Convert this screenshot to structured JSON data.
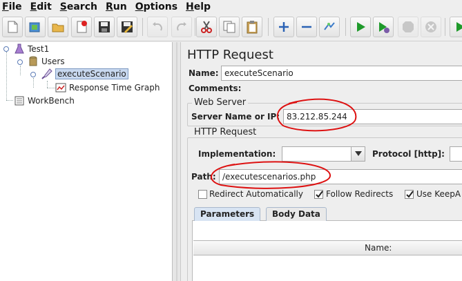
{
  "menubar": {
    "items": [
      {
        "mnemonic": "F",
        "rest": "ile"
      },
      {
        "mnemonic": "E",
        "rest": "dit"
      },
      {
        "mnemonic": "S",
        "rest": "earch"
      },
      {
        "mnemonic": "R",
        "rest": "un"
      },
      {
        "mnemonic": "O",
        "rest": "ptions"
      },
      {
        "mnemonic": "H",
        "rest": "elp"
      }
    ]
  },
  "toolbar": {
    "buttons": [
      "new-icon",
      "templates-icon",
      "open-icon",
      "close-icon",
      "save-icon",
      "save-as-icon",
      "undo-icon",
      "redo-icon",
      "cut-icon",
      "copy-icon",
      "paste-icon",
      "expand-icon",
      "collapse-icon",
      "toggle-icon",
      "start-icon",
      "start-no-pause-icon",
      "stop-icon",
      "shutdown-icon",
      "remote-start-icon"
    ]
  },
  "tree": {
    "test_plan": "Test1",
    "thread_group": "Users",
    "sampler": "executeScenario",
    "listener": "Response Time Graph",
    "workbench": "WorkBench"
  },
  "panel": {
    "title": "HTTP Request",
    "name_label": "Name:",
    "name_value": "executeScenario",
    "comments_label": "Comments:",
    "web_server": {
      "title": "Web Server",
      "server_label": "Server Name or IP:",
      "server_value": "83.212.85.244"
    },
    "http_request": {
      "title": "HTTP Request",
      "implementation_label": "Implementation:",
      "implementation_value": "",
      "protocol_label": "Protocol [http]:",
      "protocol_value": "",
      "path_label": "Path:",
      "path_value": "/executescenarios.php",
      "redirect_label": "Redirect Automatically",
      "redirect_checked": false,
      "follow_label": "Follow Redirects",
      "follow_checked": true,
      "keepalive_label": "Use KeepA",
      "keepalive_checked": true
    },
    "tabs": [
      {
        "label": "Parameters",
        "active": true
      },
      {
        "label": "Body Data",
        "active": false
      }
    ],
    "table": {
      "column_header": "Name:"
    }
  },
  "colors": {
    "annotation": "#dd1111",
    "selection": "#c8d8ef",
    "tab_active": "#d8e4f3"
  }
}
